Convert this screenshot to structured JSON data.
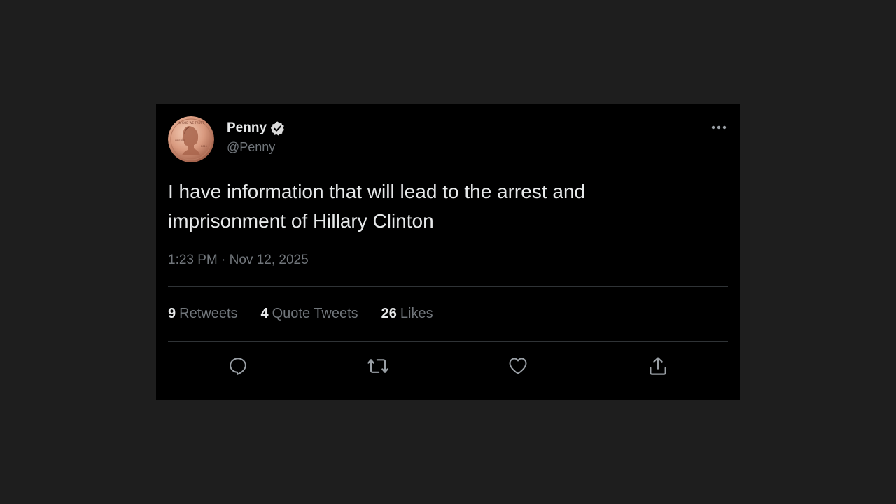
{
  "author": {
    "display_name": "Penny",
    "handle": "@Penny",
    "verified": true,
    "avatar": "penny-coin-avatar",
    "verified_icon": "verified-badge-icon"
  },
  "tweet": {
    "text": "I have information that will lead to the arrest and imprisonment of Hillary Clinton",
    "timestamp": "1:23 PM · Nov 12, 2025"
  },
  "stats": [
    {
      "count": "9",
      "label": "Retweets"
    },
    {
      "count": "4",
      "label": "Quote Tweets"
    },
    {
      "count": "26",
      "label": "Likes"
    }
  ],
  "actions": [
    {
      "name": "reply",
      "icon": "reply-icon"
    },
    {
      "name": "retweet",
      "icon": "retweet-icon"
    },
    {
      "name": "like",
      "icon": "heart-icon"
    },
    {
      "name": "share",
      "icon": "share-icon"
    }
  ],
  "colors": {
    "page_background": "#1e1e1e",
    "card_background": "#000000",
    "primary_text": "#e7e9ea",
    "secondary_text": "#71767b",
    "divider": "#2f3336",
    "verified_badge": "#d9d9d9"
  }
}
